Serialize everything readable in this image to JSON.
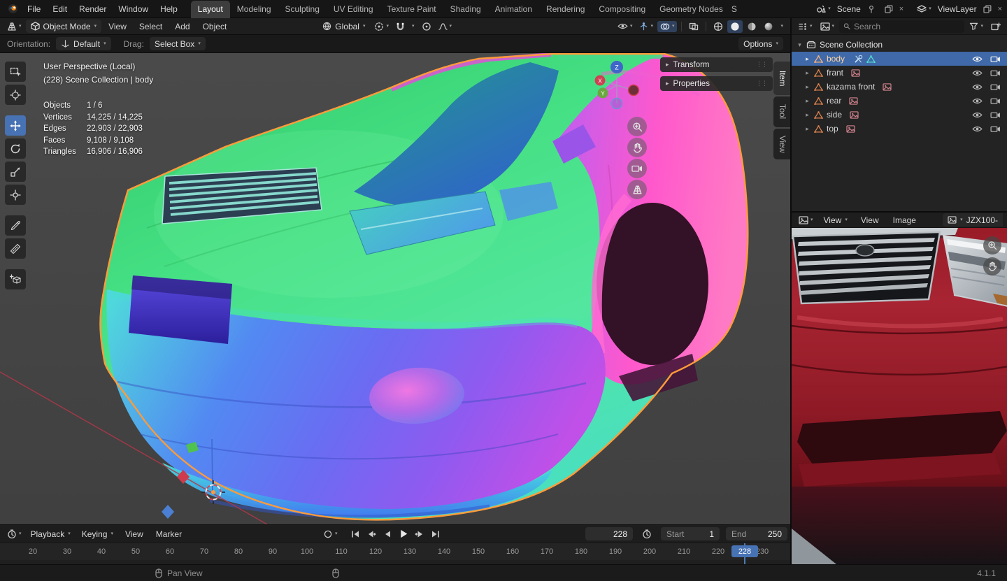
{
  "topbar": {
    "menus": [
      "File",
      "Edit",
      "Render",
      "Window",
      "Help"
    ],
    "workspaces": [
      "Layout",
      "Modeling",
      "Sculpting",
      "UV Editing",
      "Texture Paint",
      "Shading",
      "Animation",
      "Rendering",
      "Compositing",
      "Geometry Nodes",
      "S"
    ],
    "scene_label": "Scene",
    "view_layer_label": "ViewLayer"
  },
  "viewport_header": {
    "mode": "Object Mode",
    "menus": [
      "View",
      "Select",
      "Add",
      "Object"
    ],
    "orientation": "Global"
  },
  "tool_settings": {
    "orientation_label": "Orientation:",
    "orientation_value": "Default",
    "drag_label": "Drag:",
    "drag_value": "Select Box",
    "options_label": "Options"
  },
  "viewport": {
    "overlay_line1": "User Perspective (Local)",
    "overlay_line2": "(228) Scene Collection | body",
    "stats": [
      {
        "label": "Objects",
        "value": "1 / 6"
      },
      {
        "label": "Vertices",
        "value": "14,225 / 14,225"
      },
      {
        "label": "Edges",
        "value": "22,903 / 22,903"
      },
      {
        "label": "Faces",
        "value": "9,108 / 9,108"
      },
      {
        "label": "Triangles",
        "value": "16,906 / 16,906"
      }
    ],
    "npanel": {
      "transform_label": "Transform",
      "properties_label": "Properties",
      "tabs": [
        "Item",
        "Tool",
        "View"
      ]
    },
    "axis": {
      "x": "X",
      "y": "Y",
      "z": "Z"
    }
  },
  "outliner": {
    "search_placeholder": "Search",
    "scene_collection_label": "Scene Collection",
    "items": [
      {
        "label": "body"
      },
      {
        "label": "frant"
      },
      {
        "label": "kazama front"
      },
      {
        "label": "rear"
      },
      {
        "label": "side"
      },
      {
        "label": "top"
      }
    ]
  },
  "image_editor": {
    "mode_label": "View",
    "menus": [
      "View",
      "Image"
    ],
    "image_name": "JZX100-"
  },
  "timeline": {
    "menus": [
      "Playback",
      "Keying",
      "View",
      "Marker"
    ],
    "current_frame": "228",
    "start_label": "Start",
    "start_value": "1",
    "end_label": "End",
    "end_value": "250",
    "ticks": [
      "20",
      "30",
      "40",
      "50",
      "60",
      "70",
      "80",
      "90",
      "100",
      "110",
      "120",
      "130",
      "140",
      "150",
      "160",
      "170",
      "180",
      "190",
      "200",
      "210",
      "220",
      "230"
    ]
  },
  "statusbar": {
    "pan_hint": "Pan View",
    "version": "4.1.1"
  },
  "colors": {
    "accent_blue": "#4772b3",
    "selection_outline": "#ff9b3a"
  }
}
